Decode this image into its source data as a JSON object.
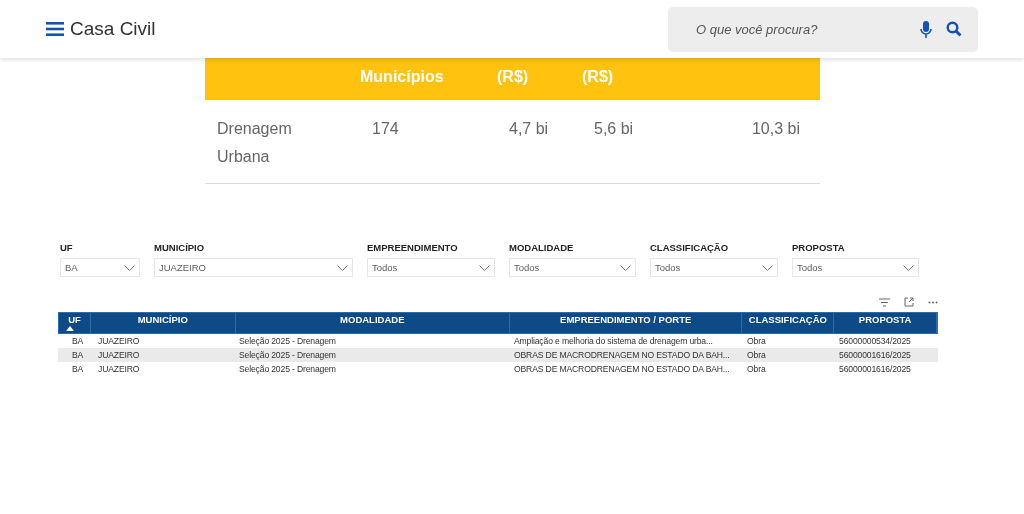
{
  "header": {
    "title": "Casa Civil",
    "search": {
      "placeholder": "O que você procura?"
    }
  },
  "summary": {
    "columns": [
      "Municípios",
      "(R$)",
      "(R$)"
    ],
    "rows": [
      {
        "label": "Drenagem Urbana",
        "cells": [
          "174",
          "4,7 bi",
          "5,6 bi",
          "10,3 bi"
        ]
      }
    ]
  },
  "filters": [
    {
      "label": "UF",
      "value": "BA"
    },
    {
      "label": "MUNICÍPIO",
      "value": "JUAZEIRO"
    },
    {
      "label": "EMPREENDIMENTO",
      "value": "Todos"
    },
    {
      "label": "MODALIDADE",
      "value": "Todos"
    },
    {
      "label": "CLASSIFICAÇÃO",
      "value": "Todos"
    },
    {
      "label": "PROPOSTA",
      "value": "Todos"
    }
  ],
  "table": {
    "columns": [
      "UF",
      "MUNICÍPIO",
      "MODALIDADE",
      "EMPREENDIMENTO / PORTE",
      "CLASSIFICAÇÃO",
      "PROPOSTA"
    ],
    "rows": [
      [
        "BA",
        "JUAZEIRO",
        "Seleção 2025 - Drenagem",
        "Ampliação e melhoria do sistema de drenagem urba...",
        "Obra",
        "56000000534/2025"
      ],
      [
        "BA",
        "JUAZEIRO",
        "Seleção 2025 - Drenagem",
        "OBRAS DE MACRODRENAGEM NO ESTADO DA BAH...",
        "Obra",
        "56000001616/2025"
      ],
      [
        "BA",
        "JUAZEIRO",
        "Seleção 2025 - Drenagem",
        "OBRAS DE MACRODRENAGEM NO ESTADO DA BAH...",
        "Obra",
        "56000001616/2025"
      ]
    ]
  }
}
